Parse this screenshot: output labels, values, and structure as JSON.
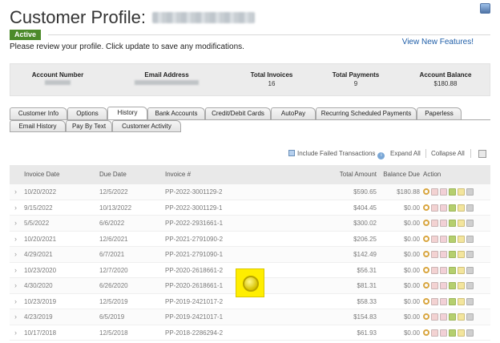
{
  "header": {
    "title": "Customer Profile:",
    "status": "Active",
    "review_text": "Please review your profile. Click update to save any modifications.",
    "new_features_link": "View New Features!"
  },
  "summary": {
    "account_number_label": "Account Number",
    "email_label": "Email Address",
    "total_invoices_label": "Total Invoices",
    "total_invoices": "16",
    "total_payments_label": "Total Payments",
    "total_payments": "9",
    "account_balance_label": "Account Balance",
    "account_balance": "$180.88"
  },
  "tabs_row1": [
    "Customer Info",
    "Options",
    "History",
    "Bank Accounts",
    "Credit/Debit Cards",
    "AutoPay",
    "Recurring Scheduled Payments",
    "Paperless"
  ],
  "tabs_row2": [
    "Email History",
    "Pay By Text",
    "Customer Activity"
  ],
  "active_tab": "History",
  "controls": {
    "include_failed": "Include Failed Transactions",
    "expand_all": "Expand All",
    "collapse_all": "Collapse All"
  },
  "table": {
    "headers": [
      "Invoice Date",
      "Due Date",
      "Invoice #",
      "Total Amount",
      "Balance Due",
      "Action"
    ],
    "rows": [
      {
        "invoice_date": "10/20/2022",
        "due_date": "12/5/2022",
        "invoice_no": "PP-2022-3001129-2",
        "total": "$590.65",
        "balance": "$180.88"
      },
      {
        "invoice_date": "9/15/2022",
        "due_date": "10/13/2022",
        "invoice_no": "PP-2022-3001129-1",
        "total": "$404.45",
        "balance": "$0.00"
      },
      {
        "invoice_date": "5/5/2022",
        "due_date": "6/6/2022",
        "invoice_no": "PP-2022-2931661-1",
        "total": "$300.02",
        "balance": "$0.00"
      },
      {
        "invoice_date": "10/20/2021",
        "due_date": "12/6/2021",
        "invoice_no": "PP-2021-2791090-2",
        "total": "$206.25",
        "balance": "$0.00"
      },
      {
        "invoice_date": "4/29/2021",
        "due_date": "6/7/2021",
        "invoice_no": "PP-2021-2791090-1",
        "total": "$142.49",
        "balance": "$0.00"
      },
      {
        "invoice_date": "10/23/2020",
        "due_date": "12/7/2020",
        "invoice_no": "PP-2020-2618661-2",
        "total": "$56.31",
        "balance": "$0.00"
      },
      {
        "invoice_date": "4/30/2020",
        "due_date": "6/26/2020",
        "invoice_no": "PP-2020-2618661-1",
        "total": "$81.31",
        "balance": "$0.00"
      },
      {
        "invoice_date": "10/23/2019",
        "due_date": "12/5/2019",
        "invoice_no": "PP-2019-2421017-2",
        "total": "$58.33",
        "balance": "$0.00"
      },
      {
        "invoice_date": "4/23/2019",
        "due_date": "6/5/2019",
        "invoice_no": "PP-2019-2421017-1",
        "total": "$154.83",
        "balance": "$0.00"
      },
      {
        "invoice_date": "10/17/2018",
        "due_date": "12/5/2018",
        "invoice_no": "PP-2018-2286294-2",
        "total": "$61.93",
        "balance": "$0.00"
      }
    ]
  },
  "colors": {
    "active_badge": "#4c8a2a",
    "link": "#1f5ea8",
    "cursor_highlight": "#ffee00"
  }
}
